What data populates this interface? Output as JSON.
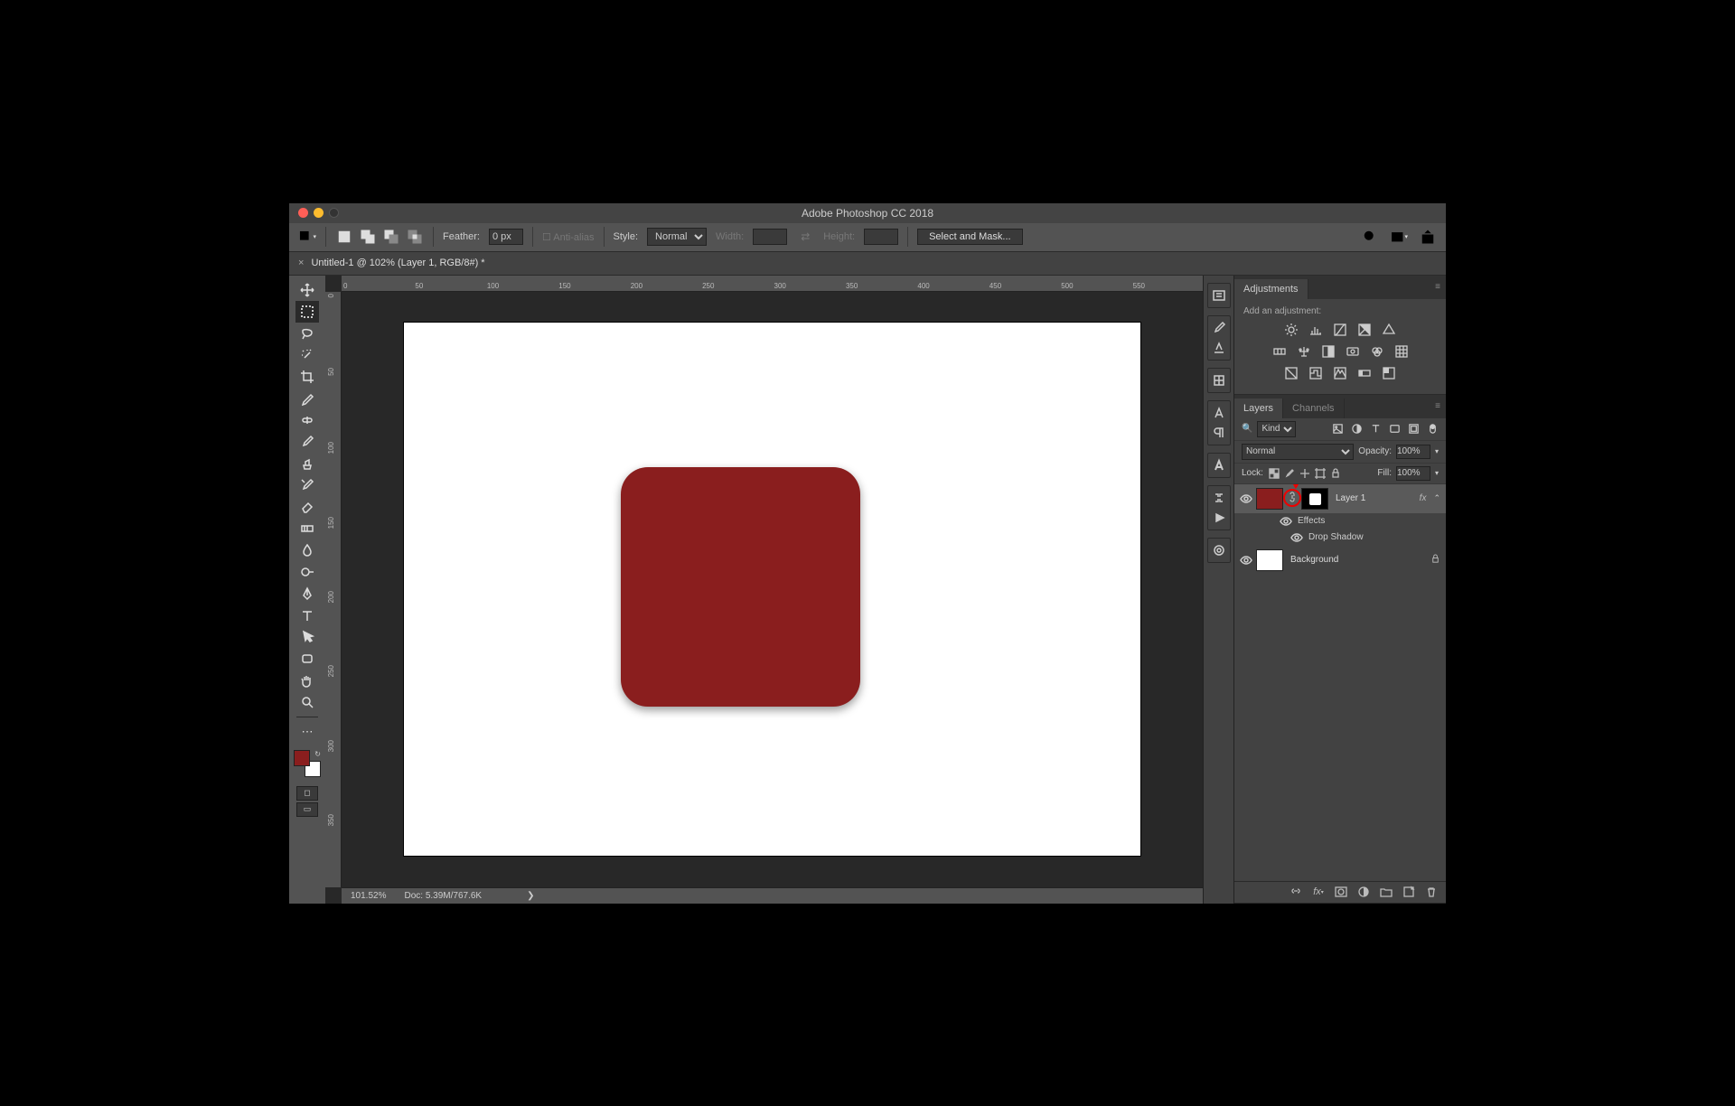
{
  "titlebar": {
    "title": "Adobe Photoshop CC 2018"
  },
  "options": {
    "feather_label": "Feather:",
    "feather_value": "0 px",
    "antialias_label": "Anti-alias",
    "style_label": "Style:",
    "style_value": "Normal",
    "width_label": "Width:",
    "height_label": "Height:",
    "mask_btn": "Select and Mask..."
  },
  "tab": {
    "name": "Untitled-1 @ 102% (Layer 1, RGB/8#) *"
  },
  "ruler_h": [
    "0",
    "50",
    "100",
    "150",
    "200",
    "250",
    "300",
    "350",
    "400",
    "450",
    "500",
    "550"
  ],
  "ruler_v": [
    "0",
    "50",
    "100",
    "150",
    "200",
    "250",
    "300",
    "350"
  ],
  "status": {
    "zoom": "101.52%",
    "doc": "Doc: 5.39M/767.6K"
  },
  "panels": {
    "adjustments": {
      "tab": "Adjustments",
      "label": "Add an adjustment:"
    },
    "layers": {
      "tab_layers": "Layers",
      "tab_channels": "Channels",
      "kind_label": "Kind",
      "blend_mode": "Normal",
      "opacity_label": "Opacity:",
      "opacity_value": "100%",
      "lock_label": "Lock:",
      "fill_label": "Fill:",
      "fill_value": "100%",
      "items": [
        {
          "name": "Layer 1",
          "fx": true
        },
        {
          "name": "Background",
          "locked": true
        }
      ],
      "effects_label": "Effects",
      "dropshadow_label": "Drop Shadow"
    }
  }
}
